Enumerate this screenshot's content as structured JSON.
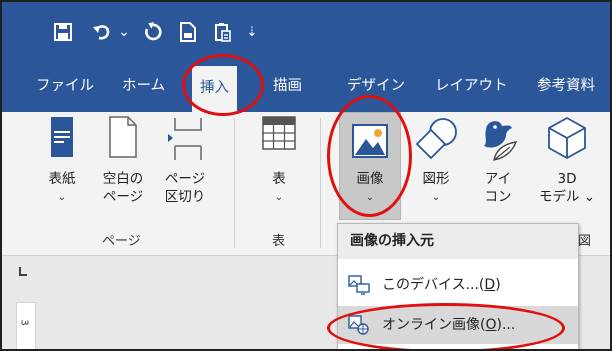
{
  "quick_access": {
    "save_icon": "save-icon",
    "undo_icon": "undo-icon",
    "undo_dropdown": "⌄",
    "redo_icon": "redo-icon",
    "new_icon": "new-document-icon",
    "paste_icon": "clipboard-icon",
    "customize": "⇣"
  },
  "tabs": [
    {
      "label": "ファイル"
    },
    {
      "label": "ホーム"
    },
    {
      "label": "挿入",
      "active": true
    },
    {
      "label": "描画"
    },
    {
      "label": "デザイン"
    },
    {
      "label": "レイアウト"
    },
    {
      "label": "参考資料"
    }
  ],
  "ribbon": {
    "pages_group": {
      "cover": {
        "line1": "表紙",
        "chevron": "⌄"
      },
      "blank": {
        "line1": "空白の",
        "line2": "ページ"
      },
      "break": {
        "line1": "ページ",
        "line2": "区切り"
      },
      "label": "ページ"
    },
    "table_group": {
      "table": {
        "line1": "表",
        "chevron": "⌄"
      },
      "label": "表"
    },
    "illustrations": {
      "image": {
        "line1": "画像",
        "chevron": "⌄"
      },
      "shapes": {
        "line1": "図形",
        "chevron": "⌄"
      },
      "icons": {
        "line1": "アイ",
        "line2": "コン"
      },
      "model3d": {
        "line1": "3D",
        "line2": "モデル ⌄"
      },
      "label_fragment": "図"
    }
  },
  "dropdown": {
    "header": "画像の挿入元",
    "items": [
      {
        "label": "このデバイス...(",
        "key": "D",
        "suffix": ")"
      },
      {
        "label": "オンライン画像(",
        "key": "O",
        "suffix": ")..."
      }
    ]
  },
  "ruler": {
    "vertical_mark": "3"
  },
  "colors": {
    "title_bar": "#2b579a",
    "ribbon_bg": "#f3f3f3",
    "annotation_red": "#e01010",
    "icon_blue": "#2b579a"
  }
}
